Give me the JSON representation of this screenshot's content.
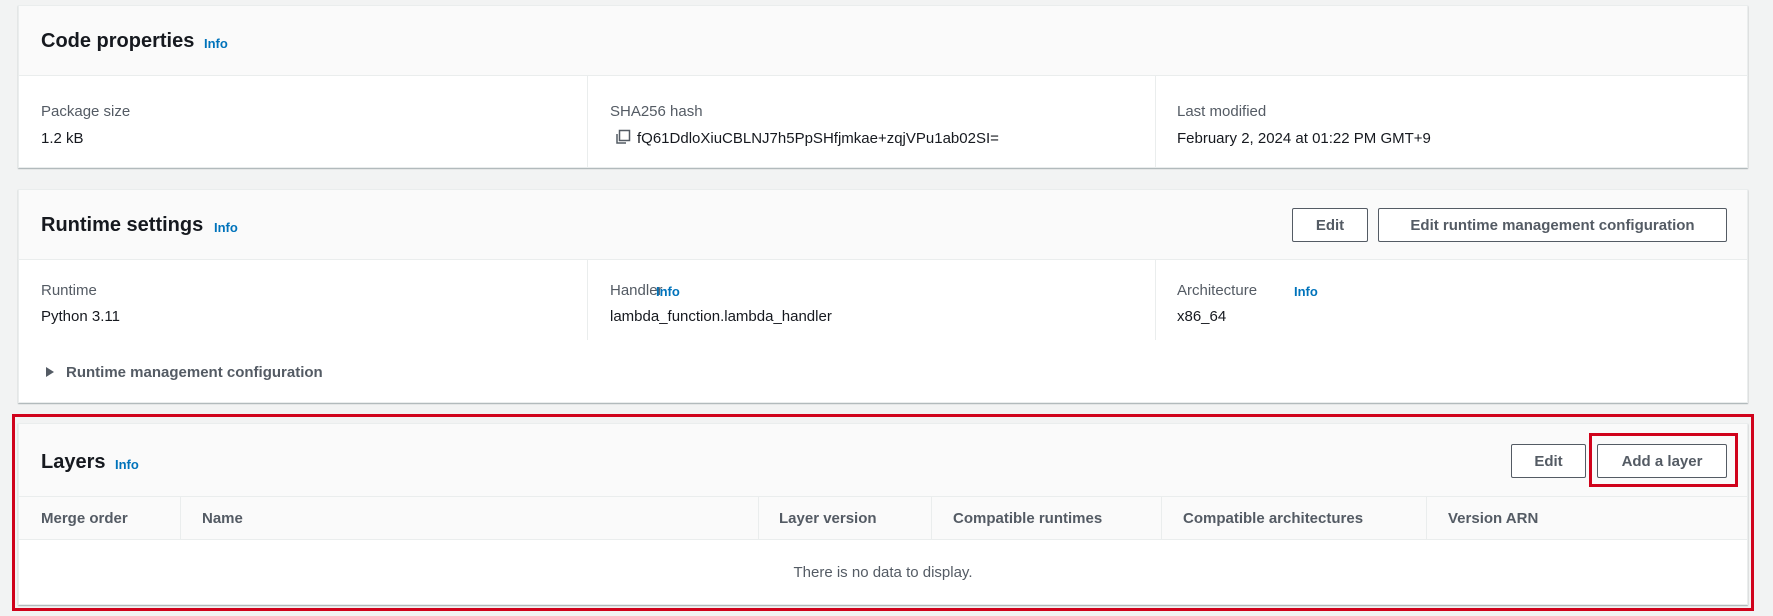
{
  "code_properties": {
    "title": "Code properties",
    "info": "Info",
    "package_size_label": "Package size",
    "package_size_value": "1.2 kB",
    "sha_label": "SHA256 hash",
    "sha_value": "fQ61DdloXiuCBLNJ7h5PpSHfjmkae+zqjVPu1ab02SI=",
    "last_modified_label": "Last modified",
    "last_modified_value": "February 2, 2024 at 01:22 PM GMT+9"
  },
  "runtime_settings": {
    "title": "Runtime settings",
    "info": "Info",
    "edit_label": "Edit",
    "edit_runtime_mgmt_label": "Edit runtime management configuration",
    "runtime_label": "Runtime",
    "runtime_value": "Python 3.11",
    "handler_label": "Handler",
    "handler_info": "Info",
    "handler_value": "lambda_function.lambda_handler",
    "architecture_label": "Architecture",
    "architecture_info": "Info",
    "architecture_value": "x86_64",
    "runtime_mgmt_toggle": "Runtime management configuration"
  },
  "layers": {
    "title": "Layers",
    "info": "Info",
    "edit_label": "Edit",
    "add_layer_label": "Add a layer",
    "columns": [
      "Merge order",
      "Name",
      "Layer version",
      "Compatible runtimes",
      "Compatible architectures",
      "Version ARN"
    ],
    "empty_message": "There is no data to display."
  },
  "colors": {
    "link": "#0073bb",
    "highlight": "#d0021b",
    "button_border": "#545b64"
  },
  "icons": {
    "copy": "copy-icon",
    "expand": "caret-right-icon"
  }
}
